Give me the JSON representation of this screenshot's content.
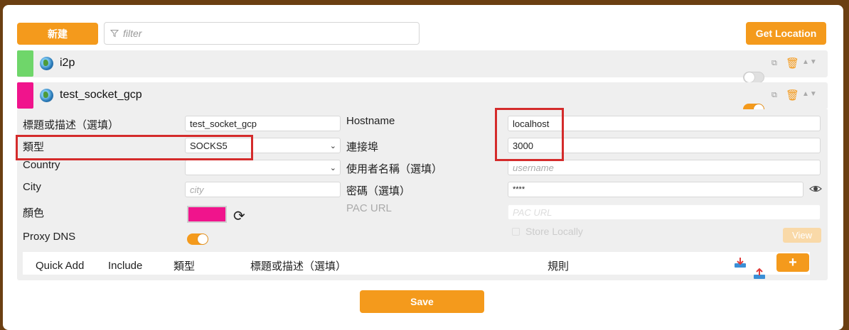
{
  "toolbar": {
    "new_label": "新建",
    "filter_placeholder": "filter",
    "get_location_label": "Get Location"
  },
  "proxies": [
    {
      "name": "i2p",
      "color": "#6fd66a",
      "enabled": false
    },
    {
      "name": "test_socket_gcp",
      "color": "#f0148c",
      "enabled": true
    }
  ],
  "form": {
    "title_label": "標題或描述（選填）",
    "title_value": "test_socket_gcp",
    "type_label": "類型",
    "type_value": "SOCKS5",
    "country_label": "Country",
    "country_value": "",
    "city_label": "City",
    "city_placeholder": "city",
    "color_label": "顏色",
    "color_value": "#f0148c",
    "proxy_dns_label": "Proxy DNS",
    "proxy_dns_enabled": true,
    "hostname_label": "Hostname",
    "hostname_value": "localhost",
    "port_label": "連接埠",
    "port_value": "3000",
    "username_label": "使用者名稱（選填）",
    "username_placeholder": "username",
    "password_label": "密碼（選填）",
    "password_value": "****",
    "pac_url_label": "PAC URL",
    "pac_url_placeholder": "PAC URL",
    "store_locally_label": "Store Locally",
    "view_label": "View"
  },
  "rules_table": {
    "headers": [
      "Quick Add",
      "Include",
      "類型",
      "標題或描述（選填）",
      "規則"
    ]
  },
  "save_label": "Save",
  "colors": {
    "accent": "#f49a1c",
    "highlight": "#d42b2b",
    "background": "#6b3f12"
  }
}
